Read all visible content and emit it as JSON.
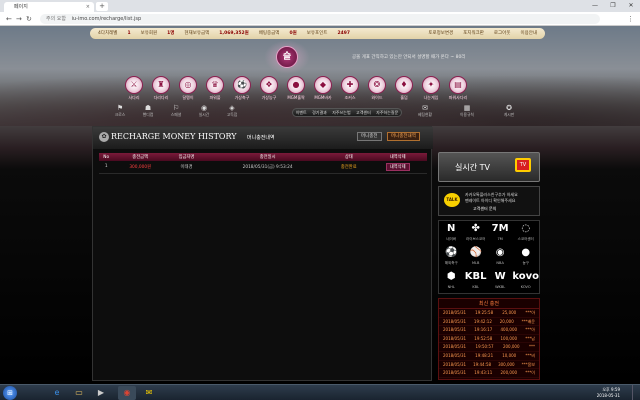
{
  "browser": {
    "tab_title": "페이지",
    "tab_close": "×",
    "new_tab": "+",
    "window_buttons": [
      "—",
      "❐",
      "✕"
    ],
    "nav": {
      "back": "←",
      "forward": "→",
      "reload": "↻"
    },
    "url_secure_label": "주의 요함",
    "url": "iu-imo.com/recharge/list.jsp",
    "menu": "⋮"
  },
  "site": {
    "topbar": {
      "user_level_label": "4다치레벨",
      "user_level_value": "1",
      "joined_label": "보유회원",
      "joined_value": "1명",
      "money_label": "현재보유금액",
      "money_value": "1,069,352원",
      "bonus_label": "배팅중금액",
      "bonus_value": "0원",
      "point_label": "보유포인트",
      "point_value": "2497",
      "links": [
        "토로정보변경",
        "포지워크판",
        "로그아웃",
        "이용안내"
      ]
    },
    "logo_text": "슬",
    "notice": "공올 게표 간직하고 있는만 안되서 설명할 때가 온다 ~ 80리",
    "icons": [
      {
        "glyph": "⚔",
        "label": "사다리"
      },
      {
        "glyph": "♜",
        "label": "다리다리"
      },
      {
        "glyph": "◎",
        "label": "달팽이"
      },
      {
        "glyph": "♛",
        "label": "파워볼"
      },
      {
        "glyph": "⚽",
        "label": "가상축구"
      },
      {
        "glyph": "❖",
        "label": "가상농구"
      },
      {
        "glyph": "●",
        "label": "MGM홀짝"
      },
      {
        "glyph": "◆",
        "label": "MGM바카"
      },
      {
        "glyph": "✚",
        "label": "조커스"
      },
      {
        "glyph": "❂",
        "label": "와이드"
      },
      {
        "glyph": "♦",
        "label": "홀덤"
      },
      {
        "glyph": "✦",
        "label": "나눈게임"
      },
      {
        "glyph": "▤",
        "label": "파워사다리"
      }
    ],
    "subnav_left": [
      {
        "glyph": "⚑",
        "label": "크로스"
      },
      {
        "glyph": "☗",
        "label": "핸디캡"
      },
      {
        "glyph": "⚐",
        "label": "스페셜"
      },
      {
        "glyph": "◉",
        "label": "실시간"
      },
      {
        "glyph": "◈",
        "label": "고득점"
      }
    ],
    "subnav_pill": [
      "이벤트",
      "경기결과",
      "자주쓰는법",
      "고객센터",
      "자주하는질문"
    ],
    "subnav_right": [
      {
        "glyph": "✉",
        "label": "베팅현황"
      },
      {
        "glyph": "▦",
        "label": "이용규칙"
      },
      {
        "glyph": "✪",
        "label": "게시판"
      }
    ]
  },
  "content": {
    "icon": "✿",
    "title": "RECHARGE MONEY HISTORY",
    "subtitle": "머니충전내역",
    "btn_charge": "머니충전",
    "btn_history": "머니충전내역",
    "columns": [
      "No",
      "충전금액",
      "입금자명",
      "충전일시",
      "상태",
      "내역삭제"
    ],
    "rows": [
      {
        "no": "1",
        "amount": "300,000원",
        "name": "이태경",
        "date": "2018/05/31(금) 9:53:24",
        "status": "충전완료",
        "action": "내역삭제"
      }
    ]
  },
  "sidebar": {
    "live_title": "실시간 TV",
    "tv_label": "TV",
    "talk_badge": "TALK",
    "talk_line1": "카카오톡플러스친구추가 하세요",
    "talk_line2": "팬레이트 아이디 확인해주세요",
    "talk_line3": "고객센터 문의",
    "sports": [
      {
        "glyph": "N",
        "label": "네이버"
      },
      {
        "glyph": "✤",
        "label": "라이브스코어"
      },
      {
        "glyph": "7M",
        "label": "7M"
      },
      {
        "glyph": "◌",
        "label": "스코어센터"
      },
      {
        "glyph": "⚽",
        "label": "해외축구"
      },
      {
        "glyph": "⚾",
        "label": "MLB"
      },
      {
        "glyph": "◉",
        "label": "NBA"
      },
      {
        "glyph": "●",
        "label": "농구"
      },
      {
        "glyph": "⬢",
        "label": "NHL"
      },
      {
        "glyph": "KBL",
        "label": "KBL"
      },
      {
        "glyph": "W",
        "label": "WKBL"
      },
      {
        "glyph": "kovo",
        "label": "KOVO"
      }
    ],
    "recent_title": "최신 충전",
    "recent": [
      {
        "date": "2018/05/31",
        "time": "19:25:58",
        "amount": "25,000",
        "user": "***아"
      },
      {
        "date": "2018/05/31",
        "time": "19:42:12",
        "amount": "20,000",
        "user": "***배운"
      },
      {
        "date": "2018/05/31",
        "time": "19:16:17",
        "amount": "400,000",
        "user": "***아"
      },
      {
        "date": "2018/05/31",
        "time": "19:52:58",
        "amount": "100,000",
        "user": "***남"
      },
      {
        "date": "2018/05/31",
        "time": "19:50:57",
        "amount": "200,000",
        "user": "***"
      },
      {
        "date": "2018/05/31",
        "time": "19:48:21",
        "amount": "10,000",
        "user": "***비"
      },
      {
        "date": "2018/05/31",
        "time": "19:44:58",
        "amount": "300,000",
        "user": "***몸보"
      },
      {
        "date": "2018/05/31",
        "time": "19:43:11",
        "amount": "200,000",
        "user": "***이"
      }
    ]
  },
  "taskbar": {
    "start": "⊞",
    "apps": [
      {
        "glyph": "e",
        "color": "#3a8ee6"
      },
      {
        "glyph": "▭",
        "color": "#e8c060"
      },
      {
        "glyph": "▶",
        "color": "#444"
      },
      {
        "glyph": "◉",
        "color": "#dd4433"
      },
      {
        "glyph": "✉",
        "color": "#f8d000"
      }
    ],
    "time": "오후 9:59",
    "date": "2018-05-31"
  }
}
